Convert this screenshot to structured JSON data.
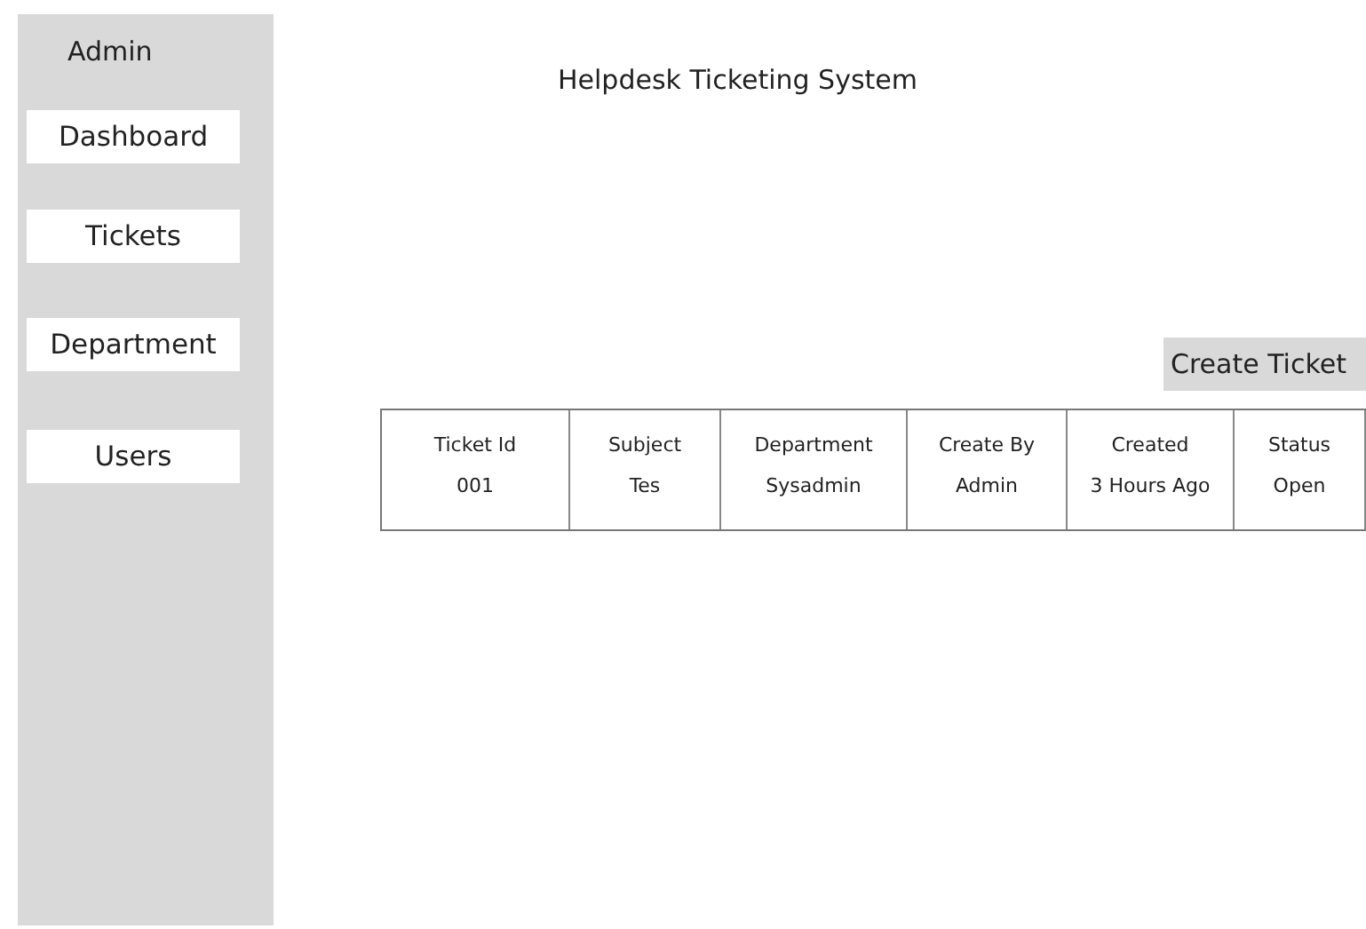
{
  "sidebar": {
    "title": "Admin",
    "items": [
      {
        "label": "Dashboard"
      },
      {
        "label": "Tickets"
      },
      {
        "label": "Department"
      },
      {
        "label": "Users"
      }
    ]
  },
  "header": {
    "title": "Helpdesk Ticketing System"
  },
  "create_button": "Create Ticket",
  "table": {
    "columns": [
      "Ticket Id",
      "Subject",
      "Department",
      "Create By",
      "Created",
      "Status"
    ],
    "rows": [
      [
        "001",
        "Tes",
        "Sysadmin",
        "Admin",
        "3 Hours Ago",
        "Open"
      ]
    ]
  }
}
